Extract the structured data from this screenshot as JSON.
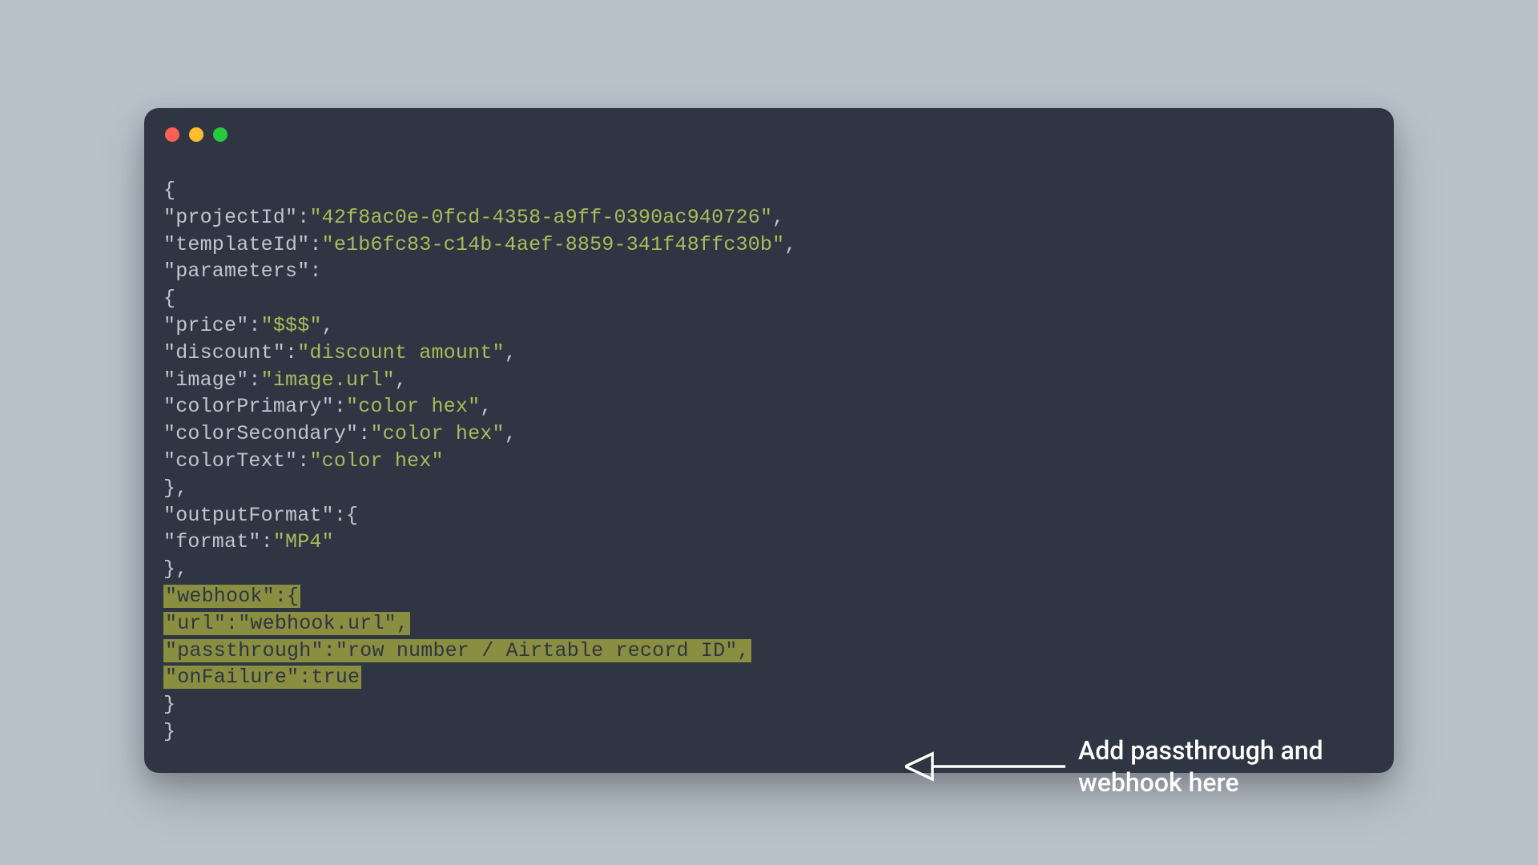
{
  "json": {
    "projectId_key": "projectId",
    "projectId_val": "42f8ac0e-0fcd-4358-a9ff-0390ac940726",
    "templateId_key": "templateId",
    "templateId_val": "e1b6fc83-c14b-4aef-8859-341f48ffc30b",
    "parameters_key": "parameters",
    "price_key": "price",
    "price_val": "$$$",
    "discount_key": "discount",
    "discount_val": "discount amount",
    "image_key": "image",
    "image_val": "image.url",
    "colorPrimary_key": "colorPrimary",
    "colorPrimary_val": "color hex",
    "colorSecondary_key": "colorSecondary",
    "colorSecondary_val": "color hex",
    "colorText_key": "colorText",
    "colorText_val": "color hex",
    "outputFormat_key": "outputFormat",
    "format_key": "format",
    "format_val": "MP4",
    "webhook_key": "webhook",
    "url_key": "url",
    "url_val": "webhook.url",
    "passthrough_key": "passthrough",
    "passthrough_val": "row number / Airtable record ID",
    "onFailure_key": "onFailure",
    "onFailure_val": "true"
  },
  "annotation": {
    "line1": "Add passthrough and",
    "line2": "webhook here"
  },
  "colors": {
    "page_bg": "#b9c2cb",
    "window_bg": "#2f3542",
    "string": "#a6be5b",
    "highlight_bg": "#898e40",
    "text_default": "#c0c5cb",
    "annotation_text": "#ffffff",
    "dot_red": "#ff5f56",
    "dot_yellow": "#ffbd2e",
    "dot_green": "#27c93f"
  }
}
